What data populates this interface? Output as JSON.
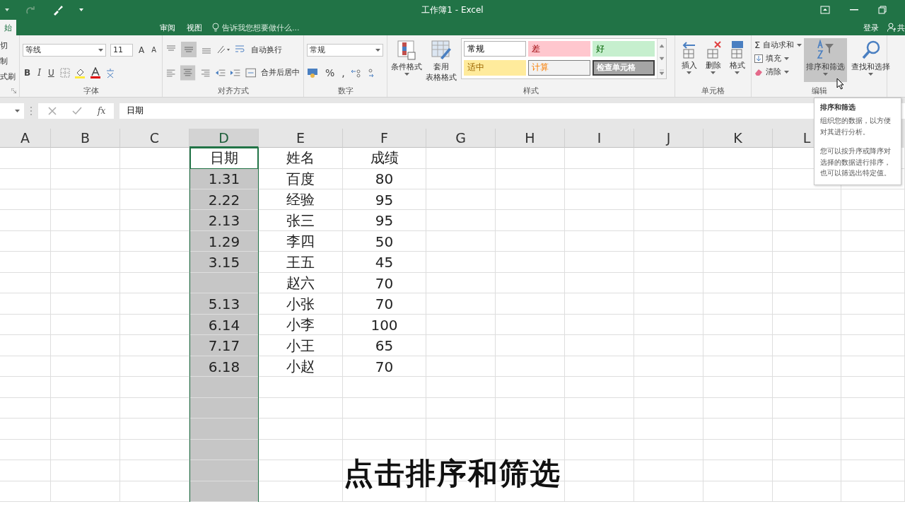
{
  "title_bar": {
    "title": "工作簿1 - Excel"
  },
  "tabs": [
    {
      "label": "始",
      "selected": true
    },
    {
      "label": "审阅",
      "selected": false
    },
    {
      "label": "视图",
      "selected": false
    }
  ],
  "tell_me": "告诉我您想要做什么...",
  "account": {
    "sign_in": "登录",
    "share": "共"
  },
  "clipboard": {
    "items": [
      "切",
      "制",
      "式刷"
    ]
  },
  "font": {
    "name": "等线",
    "size": "11",
    "grow": "A",
    "shrink": "A",
    "styles": [
      "B",
      "I",
      "U"
    ],
    "label": "字体"
  },
  "alignment": {
    "wrap": "自动换行",
    "merge": "合并后居中",
    "label": "对齐方式"
  },
  "number": {
    "format": "常规",
    "symbols": [
      "%",
      ","
    ],
    "label": "数字"
  },
  "styles": {
    "conditional": "条件格式",
    "table_top": "套用",
    "table_bottom": "表格格式",
    "cell_styles": [
      {
        "label": "常规",
        "kind": "normal"
      },
      {
        "label": "差",
        "kind": "bad"
      },
      {
        "label": "好",
        "kind": "good"
      },
      {
        "label": "适中",
        "kind": "neutral"
      },
      {
        "label": "计算",
        "kind": "calculation"
      },
      {
        "label": "检查单元格",
        "kind": "check"
      }
    ],
    "label": "样式"
  },
  "cells": {
    "buttons": [
      "插入",
      "删除",
      "格式"
    ],
    "label": "单元格"
  },
  "editing": {
    "autosum_symbol": "Σ",
    "autosum": "自动求和",
    "fill": "填充",
    "clear": "清除",
    "sort": "排序和筛选",
    "sort_hovered": true,
    "find": "查找和选择",
    "label": "编辑"
  },
  "formula_bar": {
    "fx": "fx",
    "value": "日期"
  },
  "columns": [
    {
      "letter": "A",
      "selected": false
    },
    {
      "letter": "B",
      "selected": false
    },
    {
      "letter": "C",
      "selected": false
    },
    {
      "letter": "D",
      "selected": true
    },
    {
      "letter": "E",
      "selected": false
    },
    {
      "letter": "F",
      "selected": false
    },
    {
      "letter": "G",
      "selected": false
    },
    {
      "letter": "H",
      "selected": false
    },
    {
      "letter": "I",
      "selected": false
    },
    {
      "letter": "J",
      "selected": false
    },
    {
      "letter": "K",
      "selected": false
    },
    {
      "letter": "L",
      "selected": false
    }
  ],
  "rows": [
    {
      "cells": [
        {
          "text": "日期",
          "active": true
        },
        {
          "text": "姓名",
          "active": false
        },
        {
          "text": "成绩",
          "active": false
        }
      ]
    },
    {
      "cells": [
        {
          "text": "1.31",
          "active": false
        },
        {
          "text": "百度",
          "active": false
        },
        {
          "text": "80",
          "active": false
        }
      ]
    },
    {
      "cells": [
        {
          "text": "2.22",
          "active": false
        },
        {
          "text": "经验",
          "active": false
        },
        {
          "text": "95",
          "active": false
        }
      ]
    },
    {
      "cells": [
        {
          "text": "2.13",
          "active": false
        },
        {
          "text": "张三",
          "active": false
        },
        {
          "text": "95",
          "active": false
        }
      ]
    },
    {
      "cells": [
        {
          "text": "1.29",
          "active": false
        },
        {
          "text": "李四",
          "active": false
        },
        {
          "text": "50",
          "active": false
        }
      ]
    },
    {
      "cells": [
        {
          "text": "3.15",
          "active": false
        },
        {
          "text": "王五",
          "active": false
        },
        {
          "text": "45",
          "active": false
        }
      ]
    },
    {
      "cells": [
        {},
        {
          "text": "赵六",
          "active": false
        },
        {
          "text": "70",
          "active": false
        }
      ]
    },
    {
      "cells": [
        {
          "text": "5.13",
          "active": false
        },
        {
          "text": "小张",
          "active": false
        },
        {
          "text": "70",
          "active": false
        }
      ]
    },
    {
      "cells": [
        {
          "text": "6.14",
          "active": false
        },
        {
          "text": "小李",
          "active": false
        },
        {
          "text": "100",
          "active": false
        }
      ]
    },
    {
      "cells": [
        {
          "text": "7.17",
          "active": false
        },
        {
          "text": "小王",
          "active": false
        },
        {
          "text": "65",
          "active": false
        }
      ]
    },
    {
      "cells": [
        {
          "text": "6.18",
          "active": false
        },
        {
          "text": "小赵",
          "active": false
        },
        {
          "text": "70",
          "active": false
        }
      ]
    }
  ],
  "tooltip": {
    "title": "排序和筛选",
    "paragraphs": [
      "组织您的数据，以方便对其进行分析。",
      "您可以按升序或降序对选择的数据进行排序，也可以筛选出特定值。"
    ]
  },
  "caption": "点击排序和筛选"
}
